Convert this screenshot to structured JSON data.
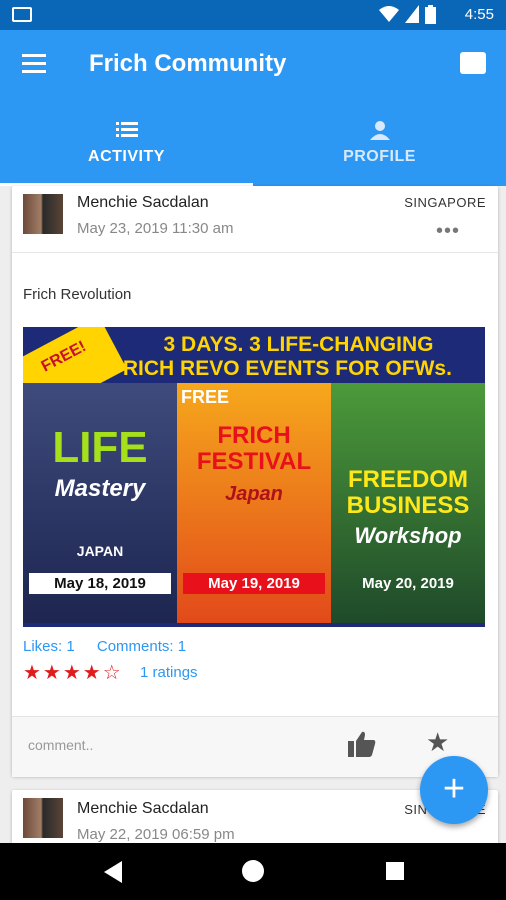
{
  "status_bar": {
    "time": "4:55"
  },
  "app_bar": {
    "title": "Frich Community"
  },
  "tabs": [
    {
      "label": "ACTIVITY",
      "icon": "list-icon",
      "active": true
    },
    {
      "label": "PROFILE",
      "icon": "person-icon",
      "active": false
    }
  ],
  "post1": {
    "author": "Menchie Sacdalan",
    "date": "May 23, 2019 11:30 am",
    "location": "SINGAPORE",
    "more": "•••",
    "title": "Frich Revolution",
    "poster": {
      "ribbon": "FREE!",
      "headline1": "3 DAYS. 3 LIFE-CHANGING",
      "headline2": "FRICH REVO EVENTS FOR OFWs.",
      "panel1_title": "LIFE",
      "panel1_sub": "Mastery",
      "panel1_country": "JAPAN",
      "panel1_date": "May 18, 2019",
      "panel2_top": "FREE",
      "panel2_title": "FRICH FESTIVAL",
      "panel2_sub": "Japan",
      "panel2_date": "May 19, 2019",
      "panel3_title": "FREEDOM BUSINESS",
      "panel3_sub": "Workshop",
      "panel3_date": "May 20, 2019"
    },
    "likes": "Likes: 1",
    "comments": "Comments: 1",
    "stars": "★★★★☆",
    "ratings": "1 ratings",
    "comment_placeholder": "comment.."
  },
  "post2": {
    "author": "Menchie Sacdalan",
    "date": "May 22, 2019 06:59 pm",
    "location": "SINGAPORE"
  },
  "fab": {
    "icon": "plus-icon",
    "label": "+"
  },
  "colors": {
    "primary": "#2d97f4",
    "statusbar": "#0a67b7",
    "star": "#e01c1c"
  }
}
